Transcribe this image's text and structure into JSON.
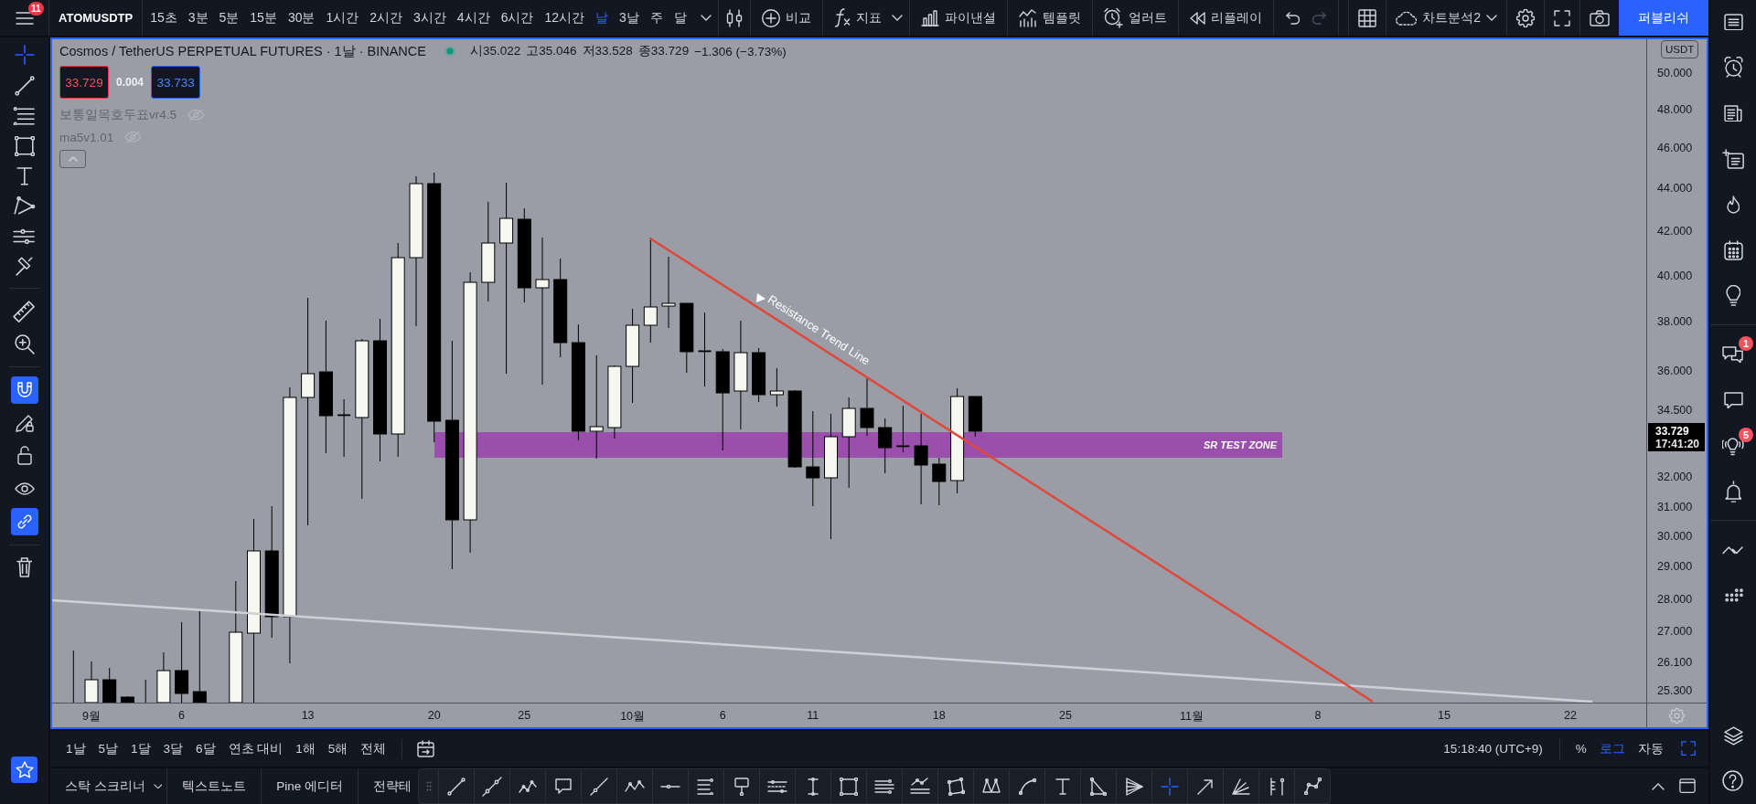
{
  "top_bar": {
    "menu_badge": "11",
    "symbol": "ATOMUSDTP",
    "intervals": [
      {
        "label": "15초",
        "selected": false
      },
      {
        "label": "3분",
        "selected": false
      },
      {
        "label": "5분",
        "selected": false
      },
      {
        "label": "15분",
        "selected": false
      },
      {
        "label": "30분",
        "selected": false
      },
      {
        "label": "1시간",
        "selected": false
      },
      {
        "label": "2시간",
        "selected": false
      },
      {
        "label": "3시간",
        "selected": false
      },
      {
        "label": "4시간",
        "selected": false
      },
      {
        "label": "6시간",
        "selected": false
      },
      {
        "label": "12시간",
        "selected": false
      },
      {
        "label": "날",
        "selected": true
      },
      {
        "label": "3날",
        "selected": false
      },
      {
        "label": "주",
        "selected": false
      },
      {
        "label": "달",
        "selected": false
      }
    ],
    "compare": "비교",
    "indicators": "지표",
    "financials": "파이낸셜",
    "templates": "템플릿",
    "alerts": "얼러트",
    "replay": "리플레이",
    "history": [
      {
        "disabled": false
      },
      {
        "disabled": true
      }
    ],
    "layout_name": "차트분석2",
    "publish": "퍼블리쉬"
  },
  "left_toolbar": {
    "tools": [
      {
        "selected": true
      },
      {
        "selected": false
      },
      {
        "selected": false
      },
      {
        "selected": false
      },
      {
        "selected": false
      },
      {
        "selected": false
      },
      {
        "selected": false
      },
      {
        "selected": false
      },
      {
        "selected": false
      },
      {
        "selected": false
      }
    ],
    "toggles": [
      {
        "on": true
      },
      {
        "on": false
      },
      {
        "on": false
      },
      {
        "on": false
      },
      {
        "on": true
      }
    ]
  },
  "chart": {
    "legend": {
      "title": "Cosmos / TetherUS PERPETUAL FUTURES · 1날 · BINANCE",
      "ohlc": [
        "시35.022",
        "고35.046",
        "저33.528",
        "종33.729",
        "−1.306 (−3.73%)"
      ],
      "sell_price": "33.729",
      "spread": "0.004",
      "buy_price": "33.733",
      "indicators": [
        {
          "name": "보통일목호두표vr4.5",
          "hidden": true
        },
        {
          "name": "ma5v1.01",
          "hidden": true
        }
      ]
    },
    "drawings": [
      {
        "kind": "zone",
        "label": "SR TEST ZONE"
      },
      {
        "kind": "line"
      },
      {
        "kind": "trend-line",
        "label": "Resistance Trend Line"
      }
    ],
    "price_axis": {
      "unit": "USDT",
      "labels": [
        "50.000",
        "48.000",
        "46.000",
        "44.000",
        "42.000",
        "40.000",
        "38.000",
        "36.000",
        "34.500",
        "32.000",
        "31.000",
        "30.000",
        "29.000",
        "28.000",
        "27.000",
        "26.100",
        "25.300"
      ],
      "last_price": "33.729",
      "countdown": "17:41:20"
    },
    "time_axis": {
      "labels": [
        "9월",
        "6",
        "13",
        "20",
        "25",
        "10월",
        "6",
        "11",
        "18",
        "25",
        "11월",
        "8",
        "15",
        "22"
      ]
    }
  },
  "range_bar": {
    "ranges": [
      "1날",
      "5날",
      "1달",
      "3달",
      "6달",
      "연초 대비",
      "1해",
      "5해",
      "전체"
    ],
    "clock": "15:18:40 (UTC+9)",
    "scale_modes": [
      {
        "label": "%",
        "selected": false
      },
      {
        "label": "로그",
        "selected": true
      },
      {
        "label": "자동",
        "selected": false
      }
    ]
  },
  "bottom_panel": {
    "tabs": [
      "스탁 스크리너",
      "텍스트노트",
      "Pine 에디터",
      "전략테"
    ],
    "drawing_tools": [
      {
        "selected": false
      },
      {
        "selected": false
      },
      {
        "selected": false
      },
      {
        "selected": false
      },
      {
        "selected": false
      },
      {
        "selected": false
      },
      {
        "selected": false
      },
      {
        "selected": false
      },
      {
        "selected": false
      },
      {
        "selected": false
      },
      {
        "selected": false
      },
      {
        "selected": false
      },
      {
        "selected": false
      },
      {
        "selected": false
      },
      {
        "selected": false
      },
      {
        "selected": false
      },
      {
        "selected": false
      },
      {
        "selected": false
      },
      {
        "selected": false
      },
      {
        "selected": false
      },
      {
        "selected": true
      },
      {
        "selected": false
      },
      {
        "selected": false
      },
      {
        "selected": false
      },
      {
        "selected": false
      }
    ]
  },
  "right_sidebar": {
    "chat_badge": "1",
    "streams_badge": "5"
  }
}
